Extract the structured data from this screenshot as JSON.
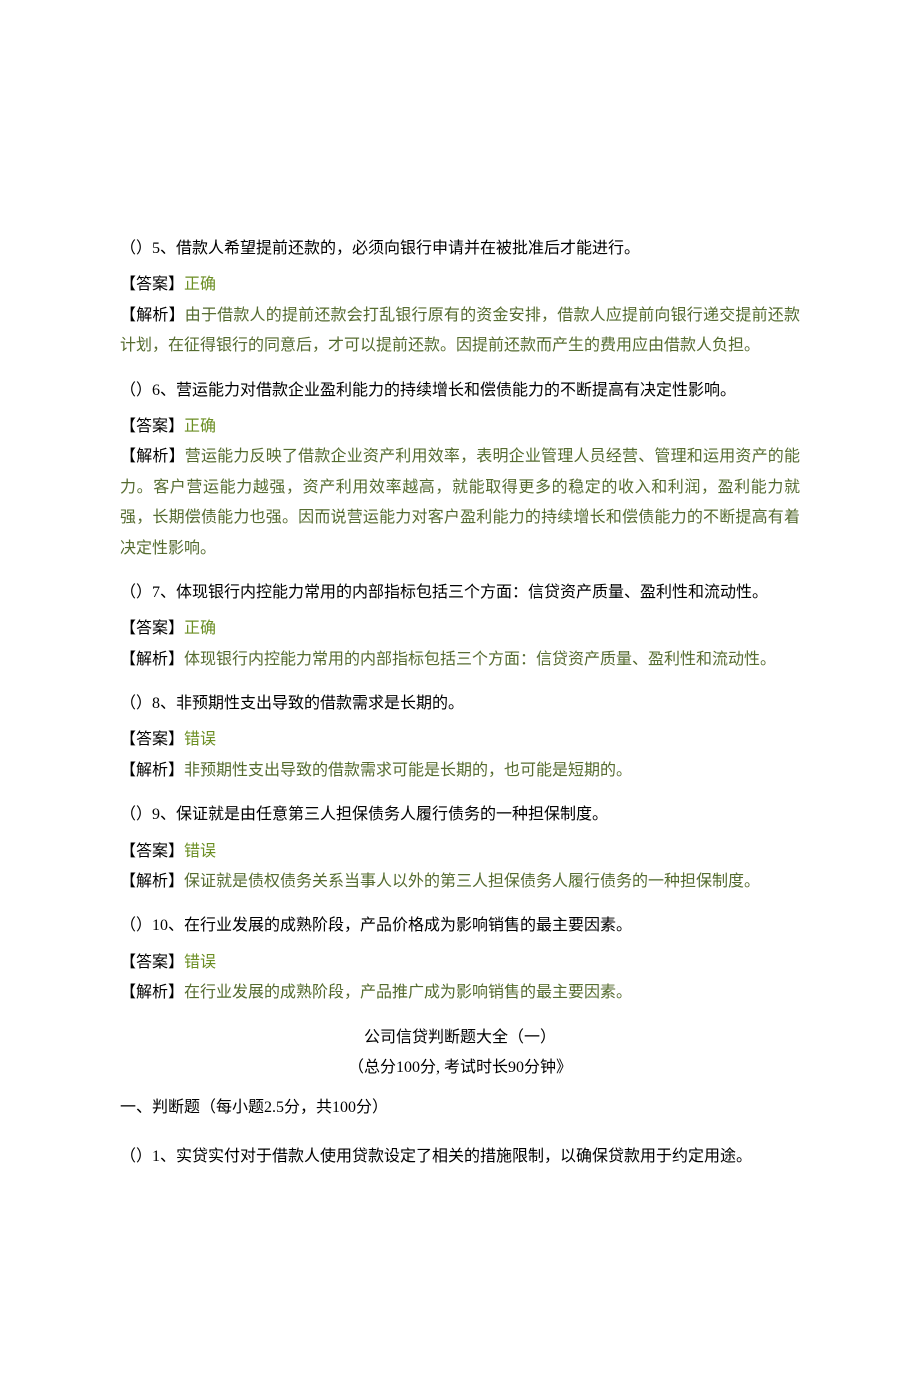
{
  "items": [
    {
      "question": "（）5、借款人希望提前还款的，必须向银行申请并在被批准后才能进行。",
      "answer_label": "【答案】",
      "answer_value": "正确",
      "explain_label": "【解析】",
      "explain_text": "由于借款人的提前还款会打乱银行原有的资金安排，借款人应提前向银行递交提前还款计划，在征得银行的同意后，才可以提前还款。因提前还款而产生的费用应由借款人负担。"
    },
    {
      "question": "（）6、营运能力对借款企业盈利能力的持续增长和偿债能力的不断提高有决定性影响。",
      "answer_label": "【答案】",
      "answer_value": "正确",
      "explain_label": "【解析】",
      "explain_text": "营运能力反映了借款企业资产利用效率，表明企业管理人员经营、管理和运用资产的能力。客户营运能力越强，资产利用效率越高，就能取得更多的稳定的收入和利润，盈利能力就强，长期偿债能力也强。因而说营运能力对客户盈利能力的持续增长和偿债能力的不断提高有着决定性影响。"
    },
    {
      "question": "（）7、体现银行内控能力常用的内部指标包括三个方面：信贷资产质量、盈利性和流动性。",
      "answer_label": "【答案】",
      "answer_value": "正确",
      "explain_label": "【解析】",
      "explain_text": "体现银行内控能力常用的内部指标包括三个方面：信贷资产质量、盈利性和流动性。"
    },
    {
      "question": "（）8、非预期性支出导致的借款需求是长期的。",
      "answer_label": "【答案】",
      "answer_value": "错误",
      "explain_label": "【解析】",
      "explain_text": "非预期性支出导致的借款需求可能是长期的，也可能是短期的。"
    },
    {
      "question": "（）9、保证就是由任意第三人担保债务人履行债务的一种担保制度。",
      "answer_label": "【答案】",
      "answer_value": "错误",
      "explain_label": "【解析】",
      "explain_text": "保证就是债权债务关系当事人以外的第三人担保债务人履行债务的一种担保制度。"
    },
    {
      "question": "（）10、在行业发展的成熟阶段，产品价格成为影响销售的最主要因素。",
      "answer_label": "【答案】",
      "answer_value": "错误",
      "explain_label": "【解析】",
      "explain_text": "在行业发展的成熟阶段，产品推广成为影响销售的最主要因素。"
    }
  ],
  "title_block": {
    "line1": "公司信贷判断题大全（一）",
    "line2": "（总分100分, 考试时长90分钟》"
  },
  "section_header": "一、判断题（每小题2.5分，共100分）",
  "next_question": "（）1、实贷实付对于借款人使用贷款设定了相关的措施限制，以确保贷款用于约定用途。"
}
